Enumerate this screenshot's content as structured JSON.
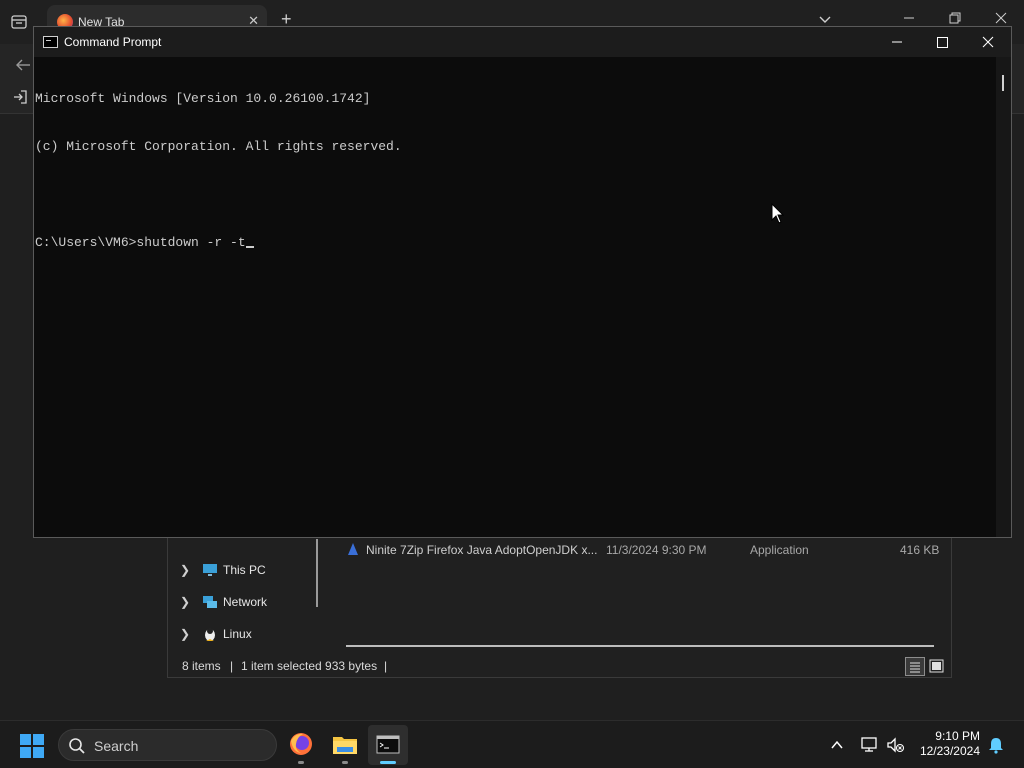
{
  "browser": {
    "tab_title": "New Tab",
    "tab_close": "✕",
    "new_tab": "+"
  },
  "explorer": {
    "nav_items": [
      {
        "label": "This PC",
        "icon": "pc-icon"
      },
      {
        "label": "Network",
        "icon": "network-icon"
      },
      {
        "label": "Linux",
        "icon": "linux-penguin-icon"
      }
    ],
    "file": {
      "name": "Ninite 7Zip Firefox Java AdoptOpenJDK x...",
      "date": "11/3/2024 9:30 PM",
      "type": "Application",
      "size": "416 KB"
    },
    "status": {
      "items": "8 items",
      "separator": "|",
      "selected": "1 item selected  933 bytes"
    }
  },
  "cmd": {
    "title": "Command Prompt",
    "lines": [
      "Microsoft Windows [Version 10.0.26100.1742]",
      "(c) Microsoft Corporation. All rights reserved.",
      "",
      "C:\\Users\\VM6>shutdown -r -t"
    ]
  },
  "taskbar": {
    "search_label": "Search",
    "time": "9:10 PM",
    "date": "12/23/2024"
  },
  "colors": {
    "accent": "#60cdff",
    "console_bg": "#0c0c0c",
    "console_text": "#cccccc",
    "taskbar_bg": "#1c1c1c"
  }
}
